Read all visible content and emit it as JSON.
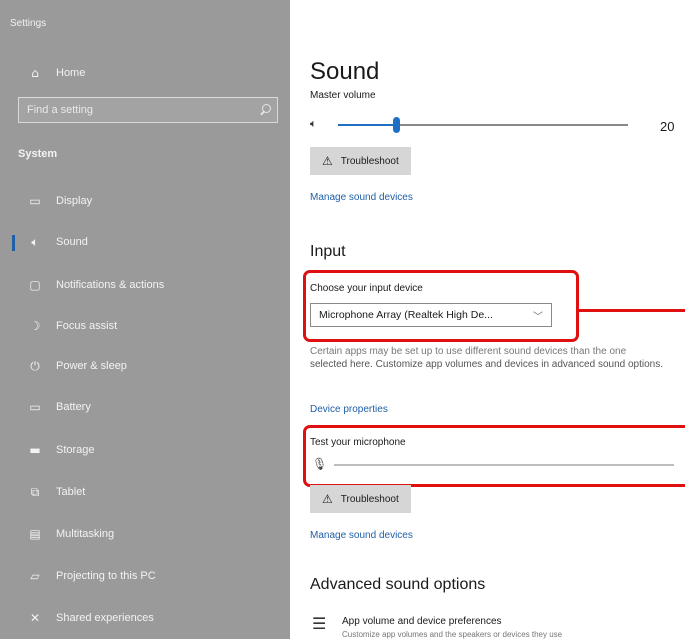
{
  "app": {
    "title": "Settings"
  },
  "sidebar": {
    "home_label": "Home",
    "search_placeholder": "Find a setting",
    "section_title": "System",
    "items": [
      {
        "label": "Display",
        "icon": "display-icon"
      },
      {
        "label": "Sound",
        "icon": "speaker-icon",
        "active": true
      },
      {
        "label": "Notifications & actions",
        "icon": "notifications-icon"
      },
      {
        "label": "Focus assist",
        "icon": "moon-icon"
      },
      {
        "label": "Power & sleep",
        "icon": "power-icon"
      },
      {
        "label": "Battery",
        "icon": "battery-icon"
      },
      {
        "label": "Storage",
        "icon": "storage-icon"
      },
      {
        "label": "Tablet",
        "icon": "tablet-icon"
      },
      {
        "label": "Multitasking",
        "icon": "multitasking-icon"
      },
      {
        "label": "Projecting to this PC",
        "icon": "projecting-icon"
      },
      {
        "label": "Shared experiences",
        "icon": "shared-icon"
      }
    ]
  },
  "main": {
    "title": "Sound",
    "master_volume_label": "Master volume",
    "master_volume_value": "20",
    "master_volume_level": 0.2,
    "troubleshoot_label": "Troubleshoot",
    "manage_devices_link": "Manage sound devices",
    "input_heading": "Input",
    "choose_input_label": "Choose your input device",
    "input_device_selected": "Microphone Array (Realtek High De...",
    "input_description_strike": "Certain apps may be set up to use different sound devices than the one",
    "input_description_rest": "selected here. Customize app volumes and devices in advanced sound options.",
    "device_properties_link": "Device properties",
    "test_mic_label": "Test your microphone",
    "troubleshoot_label_2": "Troubleshoot",
    "manage_devices_link_2": "Manage sound devices",
    "advanced_heading": "Advanced sound options",
    "app_volume_title": "App volume and device preferences",
    "app_volume_sub": "Customize app volumes and the speakers or devices they use"
  },
  "colors": {
    "sidebar_bg": "#9a9a9a",
    "accent": "#1f6fc5",
    "highlight": "#e01010"
  }
}
